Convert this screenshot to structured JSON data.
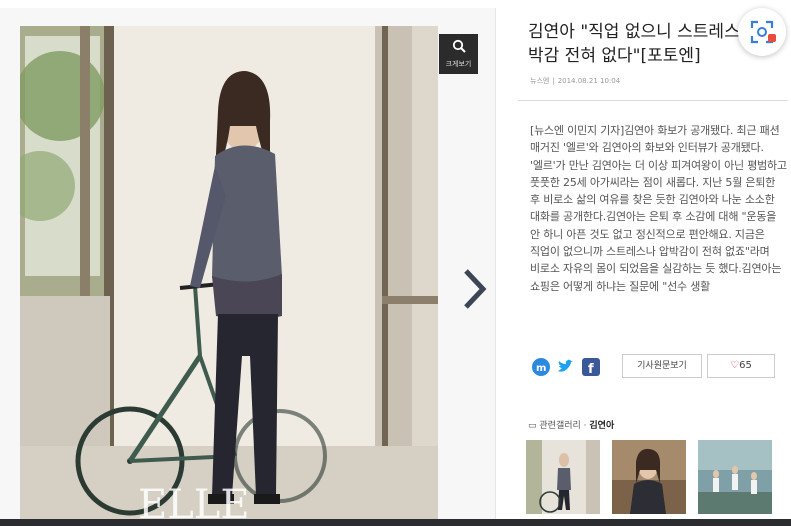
{
  "gallery": {
    "zoom_label": "크게보기",
    "magazine_logo": "ELLE",
    "next_icon": "chevron-right-icon"
  },
  "article": {
    "title": "김연아 \"직업 없으니 스트레스·압박감 전혀 없다\"[포토엔]",
    "source": "뉴스엔",
    "datetime": "2014.08.21 10:04",
    "body": "[뉴스엔 이민지 기자]김연아 화보가 공개됐다. 최근 패션 매거진 '엘르'와 김연아의 화보와 인터뷰가 공개됐다. '엘르'가 만난 김연아는 더 이상 피겨여왕이 아닌 평범하고 풋풋한 25세 아가씨라는 점이 새롭다. 지난 5월 은퇴한 후 비로소 삶의 여유를 찾은 듯한 김연아와 나눈 소소한 대화를 공개한다.김연아는 은퇴 후 소감에 대해 \"운동을 안 하니 아픈 것도 없고 정신적으로 편안해요. 지금은 직업이 없으니까 스트레스나 압박감이 전혀 없죠\"라며 비로소 자유의 몸이 되었음을 실감하는 듯 했다.김연아는 쇼핑은 어떻게 하냐는 질문에 \"선수 생활",
    "original_button": "기사원문보기",
    "like_count": "65",
    "related_label": "관련갤러리",
    "related_keyword": "김연아"
  },
  "colors": {
    "facebook": "#3b5998",
    "twitter": "#1da1f2",
    "me2day": "#2b8ae0",
    "like_heart": "#e0424a"
  }
}
